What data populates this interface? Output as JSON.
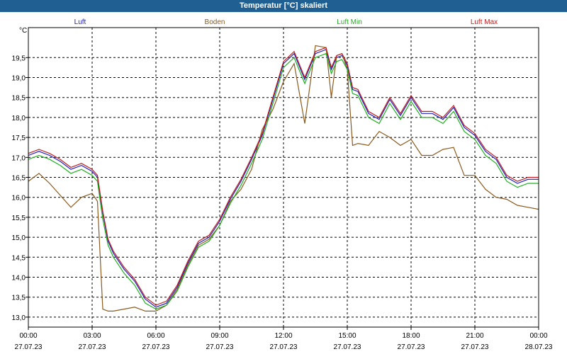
{
  "window": {
    "title": "Temperatur [°C] skaliert"
  },
  "chart_data": {
    "type": "line",
    "title": "Temperatur [°C] skaliert",
    "ylabel": "°C",
    "ylim": [
      12.75,
      20.25
    ],
    "xlim_hours": [
      0,
      24
    ],
    "grid": true,
    "legend_placement": "top",
    "y_ticks": [
      "13,0",
      "13,5",
      "14,0",
      "14,5",
      "15,0",
      "15,5",
      "16,0",
      "16,5",
      "17,0",
      "17,5",
      "18,0",
      "18,5",
      "19,0",
      "19,5"
    ],
    "y_tick_values": [
      13.0,
      13.5,
      14.0,
      14.5,
      15.0,
      15.5,
      16.0,
      16.5,
      17.0,
      17.5,
      18.0,
      18.5,
      19.0,
      19.5
    ],
    "x_ticks": [
      {
        "time": "00:00",
        "date": "27.07.23"
      },
      {
        "time": "03:00",
        "date": "27.07.23"
      },
      {
        "time": "06:00",
        "date": "27.07.23"
      },
      {
        "time": "09:00",
        "date": "27.07.23"
      },
      {
        "time": "12:00",
        "date": "27.07.23"
      },
      {
        "time": "15:00",
        "date": "27.07.23"
      },
      {
        "time": "18:00",
        "date": "27.07.23"
      },
      {
        "time": "21:00",
        "date": "27.07.23"
      },
      {
        "time": "00:00",
        "date": "28.07.23"
      }
    ],
    "x": [
      0,
      0.5,
      1,
      1.5,
      2,
      2.5,
      3,
      3.25,
      3.5,
      3.75,
      4,
      4.5,
      5,
      5.5,
      6,
      6.5,
      7,
      7.5,
      8,
      8.5,
      9,
      9.5,
      10,
      10.5,
      11,
      11.5,
      12,
      12.5,
      13,
      13.5,
      14,
      14.25,
      14.5,
      14.75,
      15,
      15.25,
      15.5,
      16,
      16.5,
      17,
      17.5,
      18,
      18.5,
      19,
      19.5,
      20,
      20.5,
      21,
      21.5,
      22,
      22.5,
      23,
      23.5,
      24
    ],
    "series": [
      {
        "name": "Luft",
        "color": "#2020c0",
        "values": [
          17.05,
          17.15,
          17.05,
          16.9,
          16.7,
          16.8,
          16.65,
          16.5,
          15.6,
          14.9,
          14.6,
          14.2,
          13.9,
          13.45,
          13.25,
          13.35,
          13.75,
          14.35,
          14.85,
          15.0,
          15.4,
          15.95,
          16.4,
          16.95,
          17.55,
          18.45,
          19.35,
          19.6,
          18.95,
          19.6,
          19.7,
          19.2,
          19.5,
          19.55,
          19.3,
          18.7,
          18.65,
          18.1,
          17.95,
          18.45,
          18.05,
          18.5,
          18.1,
          18.1,
          17.95,
          18.25,
          17.75,
          17.55,
          17.15,
          16.95,
          16.5,
          16.35,
          16.45,
          16.45
        ]
      },
      {
        "name": "Boden",
        "color": "#8b5a1e",
        "values": [
          16.4,
          16.6,
          16.35,
          16.05,
          15.75,
          16.0,
          16.1,
          15.9,
          13.2,
          13.15,
          13.15,
          13.2,
          13.25,
          13.15,
          13.15,
          13.3,
          13.7,
          14.3,
          14.8,
          14.95,
          15.3,
          15.9,
          16.2,
          16.7,
          17.7,
          18.2,
          18.9,
          19.35,
          17.85,
          19.8,
          19.75,
          18.5,
          19.55,
          19.6,
          19.2,
          17.3,
          17.35,
          17.3,
          17.65,
          17.5,
          17.3,
          17.45,
          17.05,
          17.05,
          17.2,
          17.25,
          16.55,
          16.55,
          16.2,
          16.0,
          15.95,
          15.8,
          15.75,
          15.7
        ]
      },
      {
        "name": "Luft Min",
        "color": "#20b020",
        "values": [
          16.95,
          17.05,
          16.95,
          16.8,
          16.6,
          16.7,
          16.55,
          16.4,
          15.45,
          14.8,
          14.5,
          14.1,
          13.8,
          13.35,
          13.2,
          13.3,
          13.65,
          14.25,
          14.75,
          14.9,
          15.3,
          15.85,
          16.3,
          16.85,
          17.45,
          18.35,
          19.25,
          19.5,
          18.85,
          19.5,
          19.6,
          19.1,
          19.4,
          19.45,
          19.2,
          18.6,
          18.55,
          18.0,
          17.85,
          18.35,
          17.95,
          18.4,
          18.0,
          18.0,
          17.85,
          18.15,
          17.65,
          17.45,
          17.05,
          16.85,
          16.4,
          16.25,
          16.35,
          16.35
        ]
      },
      {
        "name": "Luft Max",
        "color": "#c02020",
        "values": [
          17.1,
          17.2,
          17.1,
          16.95,
          16.75,
          16.85,
          16.7,
          16.55,
          15.65,
          14.95,
          14.65,
          14.25,
          13.95,
          13.5,
          13.3,
          13.4,
          13.8,
          14.4,
          14.9,
          15.05,
          15.45,
          16.0,
          16.45,
          17.0,
          17.6,
          18.5,
          19.4,
          19.65,
          19.0,
          19.65,
          19.75,
          19.25,
          19.55,
          19.6,
          19.35,
          18.75,
          18.7,
          18.15,
          18.0,
          18.5,
          18.1,
          18.55,
          18.15,
          18.15,
          18.0,
          18.3,
          17.8,
          17.6,
          17.2,
          17.0,
          16.55,
          16.4,
          16.5,
          16.5
        ]
      }
    ]
  }
}
